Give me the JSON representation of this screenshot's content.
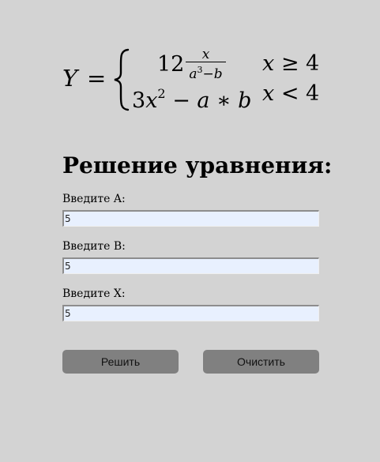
{
  "formula": {
    "lhs": "Y",
    "equals": "=",
    "case1": {
      "coefficient": "12",
      "numerator": "x",
      "denominator_var_a": "a",
      "denominator_exp": "3",
      "denominator_minus": "−",
      "denominator_var_b": "b",
      "condition_var": "x",
      "condition_op": "≥",
      "condition_value": "4"
    },
    "case2": {
      "coefficient": "3",
      "var_x": "x",
      "exp": "2",
      "minus": "−",
      "var_a": "a",
      "times": "∗",
      "var_b": "b",
      "condition_var": "x",
      "condition_op": "<",
      "condition_value": "4"
    }
  },
  "form": {
    "title": "Решение уравнения:",
    "label_a": "Введите A:",
    "label_b": "Введите B:",
    "label_x": "Введите X:",
    "value_a": "5",
    "value_b": "5",
    "value_x": "5",
    "solve_label": "Решить",
    "clear_label": "Очистить"
  }
}
